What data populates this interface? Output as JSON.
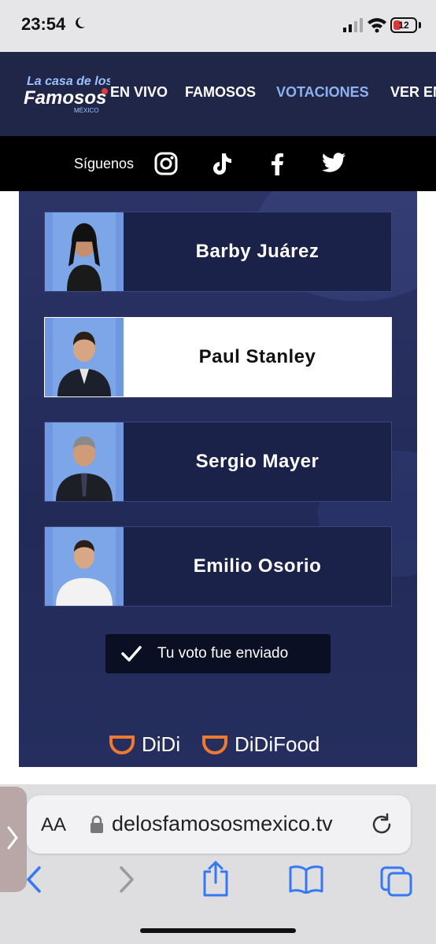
{
  "status_bar": {
    "time": "23:54",
    "battery": "12"
  },
  "header": {
    "logo_alt": "La casa de los Famosos México",
    "nav": [
      {
        "label": "EN VIVO",
        "active": false
      },
      {
        "label": "FAMOSOS",
        "active": false
      },
      {
        "label": "VOTACIONES",
        "active": true
      },
      {
        "label": "VER EN",
        "active": false
      }
    ]
  },
  "social": {
    "label": "Síguenos",
    "icons": [
      "instagram-icon",
      "tiktok-icon",
      "facebook-icon",
      "twitter-icon"
    ]
  },
  "candidates": [
    {
      "name": "Barby Juárez",
      "selected": false
    },
    {
      "name": "Paul Stanley",
      "selected": true
    },
    {
      "name": "Sergio Mayer",
      "selected": false
    },
    {
      "name": "Emilio Osorio",
      "selected": false
    }
  ],
  "vote_message": "Tu voto fue enviado",
  "sponsors": [
    "DiDi",
    "DiDi Food"
  ],
  "sponsor_words": {
    "brand": "DiDi",
    "food": "Food"
  },
  "browser": {
    "aa_label": "AA",
    "url": "delosfamososmexico.tv"
  },
  "colors": {
    "header_bg": "#202648",
    "nav_active": "#8fb0ef",
    "card_bg": "#1b2249",
    "selected_bg": "#ffffff",
    "sponsor_orange": "#ef7a2f"
  }
}
